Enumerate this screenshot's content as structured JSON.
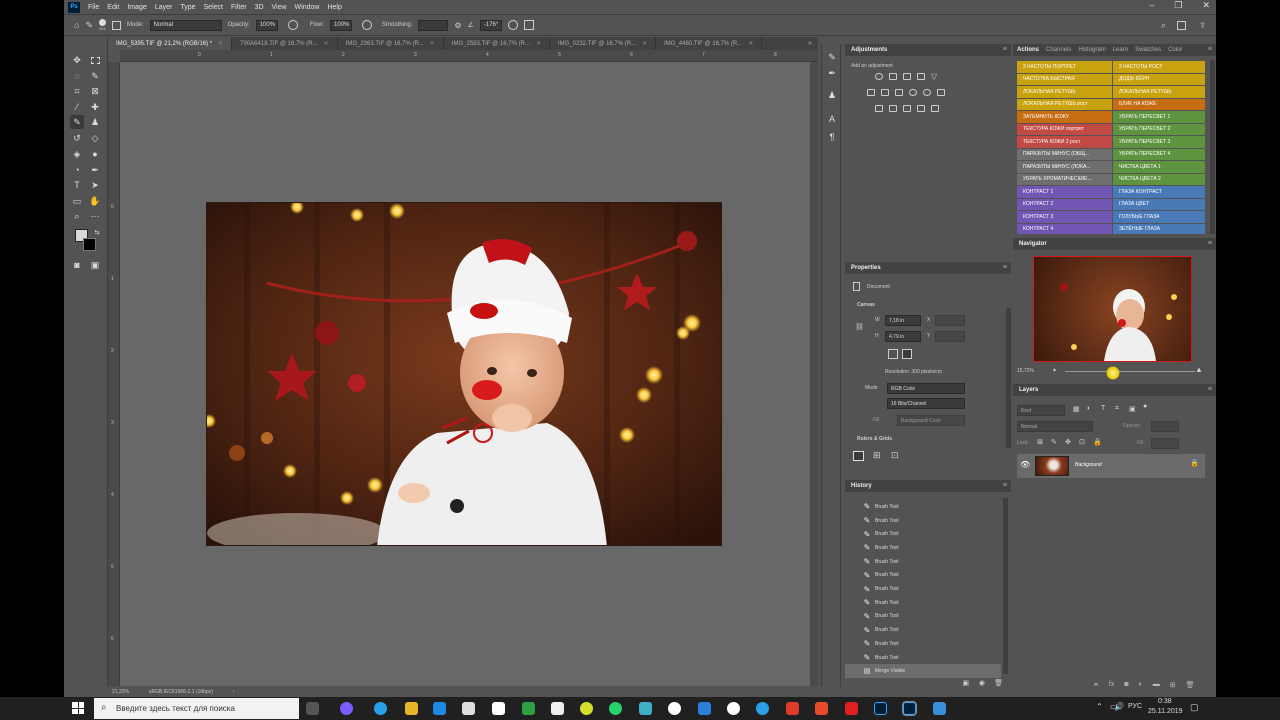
{
  "menu": {
    "logo": "Ps",
    "items": [
      "File",
      "Edit",
      "Image",
      "Layer",
      "Type",
      "Select",
      "Filter",
      "3D",
      "View",
      "Window",
      "Help"
    ]
  },
  "options": {
    "mode_label": "Mode:",
    "mode_value": "Normal",
    "opacity_label": "Opacity:",
    "opacity_value": "100%",
    "flow_label": "Flow:",
    "flow_value": "100%",
    "smoothing_label": "Smoothing:",
    "angle_value": "-176°",
    "brush_size": "401"
  },
  "tabs": [
    {
      "label": "IMG_5395.TIF @ 21,2% (RGB/16) *",
      "active": true
    },
    {
      "label": "790A6418.TIF @ 16,7% (R...",
      "active": false
    },
    {
      "label": "IMG_2363.TIF @ 16,7% (R...",
      "active": false
    },
    {
      "label": "IMG_2593.TIF @ 16,7% (R...",
      "active": false
    },
    {
      "label": "IMG_0232.TIF @ 16,7% (R...",
      "active": false
    },
    {
      "label": "IMG_4480.TIF @ 16,7% (R...",
      "active": false
    }
  ],
  "ruler_top": [
    "0",
    "1",
    "2",
    "3",
    "4",
    "5",
    "6",
    "7",
    "8",
    "9"
  ],
  "ruler_left": [
    "0",
    "1",
    "2",
    "3",
    "4",
    "5",
    "6"
  ],
  "status": {
    "zoom": "21,22%",
    "profile": "sRGB IEC61966-2.1 (16bpc)"
  },
  "adjustments": {
    "title": "Adjustments",
    "add_label": "Add an adjustment"
  },
  "properties": {
    "title": "Properties",
    "doc_label": "Document",
    "canvas_label": "Canvas",
    "w_label": "W",
    "w_value": "7,18 in",
    "h_label": "H",
    "h_value": "4,79 in",
    "x_label": "X",
    "y_label": "Y",
    "resolution": "Resolution: 300 pixels/cm",
    "mode_label": "Mode",
    "mode_value": "RGB Color",
    "bits_value": "16 Bits/Channel",
    "fill_label": "Fill",
    "fill_value": "Background Color",
    "rulers_label": "Rulers & Grids"
  },
  "history": {
    "title": "History",
    "items": [
      "Brush Tool",
      "Brush Tool",
      "Brush Tool",
      "Brush Tool",
      "Brush Tool",
      "Brush Tool",
      "Brush Tool",
      "Brush Tool",
      "Brush Tool",
      "Brush Tool",
      "Brush Tool",
      "Brush Tool"
    ],
    "last": "Merge Visible"
  },
  "actions": {
    "tabs": [
      "Actions",
      "Channels",
      "Histogram",
      "Learn",
      "Swatches",
      "Color"
    ],
    "left": [
      {
        "label": "3 ЧАСТОТЫ ПОРТРЕТ",
        "color": "#c9a20f"
      },
      {
        "label": "ЧАСТОТКА БЫСТРАЯ",
        "color": "#c9a20f"
      },
      {
        "label": "ЛОКАЛЬНАЯ РЕТУШЬ",
        "color": "#c9a20f"
      },
      {
        "label": "ЛОКАЛЬНАЯ РЕТУШЬ рост",
        "color": "#c9a20f"
      },
      {
        "label": "ЗАТЕМНИТЬ КОЖУ",
        "color": "#c66d12"
      },
      {
        "label": "ТЕКСТУРА КОЖИ портрет",
        "color": "#c24a44"
      },
      {
        "label": "ТЕКСТУРА КОЖИ 2 рост",
        "color": "#c24a44"
      },
      {
        "label": "ПАРАЗИТЫ МИНУС (ОБЩ...",
        "color": "#6e6e6e"
      },
      {
        "label": "ПАРАЗИТЫ МИНУС (ЛОКА...",
        "color": "#6e6e6e"
      },
      {
        "label": "УБРАТЬ ХРОМАТИЧЕСКИЕ...",
        "color": "#6e6e6e"
      },
      {
        "label": "КОНТРАСТ 1",
        "color": "#7256b3"
      },
      {
        "label": "КОНТРАСТ 2",
        "color": "#7256b3"
      },
      {
        "label": "КОНТРАСТ 3",
        "color": "#7256b3"
      },
      {
        "label": "КОНТРАСТ 4",
        "color": "#7256b3"
      }
    ],
    "right": [
      {
        "label": "3 ЧАСТОТЫ РОСТ",
        "color": "#c9a20f"
      },
      {
        "label": "ДОДЖ-БЁРН",
        "color": "#c9a20f"
      },
      {
        "label": "ЛОКАЛЬНАЯ РЕТУШЬ",
        "color": "#c9a20f"
      },
      {
        "label": "БЛИК НА КОЖЕ",
        "color": "#c66d12"
      },
      {
        "label": "УБРАТЬ ПЕРЕСВЕТ 1",
        "color": "#5e9440"
      },
      {
        "label": "УБРАТЬ ПЕРЕСВЕТ 2",
        "color": "#5e9440"
      },
      {
        "label": "УБРАТЬ ПЕРЕСВЕТ 3",
        "color": "#5e9440"
      },
      {
        "label": "УБРАТЬ ПЕРЕСВЕТ 4",
        "color": "#5e9440"
      },
      {
        "label": "ЧИСТКА ЦВЕТА 1",
        "color": "#5e9440"
      },
      {
        "label": "ЧИСТКА ЦВЕТА 2",
        "color": "#5e9440"
      },
      {
        "label": "ГЛАЗА КОНТРАСТ",
        "color": "#4a79b8"
      },
      {
        "label": "ГЛАЗА ЦВЕТ",
        "color": "#4a79b8"
      },
      {
        "label": "ГОЛУБЫЕ ГЛАЗА",
        "color": "#4a79b8"
      },
      {
        "label": "ЗЕЛЁНЫЕ ГЛАЗА",
        "color": "#4a79b8"
      }
    ]
  },
  "navigator": {
    "title": "Navigator",
    "zoom": "15,72%"
  },
  "layers": {
    "title": "Layers",
    "kind_placeholder": "Kind",
    "blend": "Normal",
    "opacity_label": "Opacity:",
    "lock_label": "Lock:",
    "fill_label": "Fill:",
    "layer_name": "Background"
  },
  "taskbar": {
    "search_placeholder": "Введите здесь текст для поиска",
    "lang": "РУС",
    "time": "0:38",
    "date": "25.11.2019"
  }
}
